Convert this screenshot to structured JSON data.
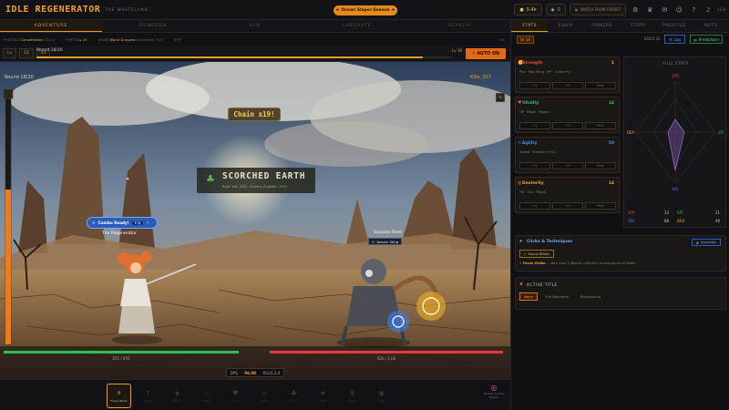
{
  "header": {
    "logo": "IDLE REGENERATOR",
    "sublogo": "THE WASTELAND",
    "season": "Ocean Slayer Season",
    "gold": "5.4k",
    "gems": "0",
    "action_link": "WATCH FROM FOREST",
    "icons": [
      "settings-icon",
      "trophy-icon",
      "mail-icon",
      "profile-icon",
      "help-icon",
      "music-icon"
    ],
    "right_label": "v1.9"
  },
  "left_tabs": [
    "ADVENTURE",
    "DUNGEON",
    "GYM",
    "LABORATE",
    "SEARCH"
  ],
  "status": {
    "feature_label": "FEATURE",
    "feature_value": "Constellation",
    "feature_extra": "CA1.0",
    "forte_label": "FORTE",
    "forte_value": "Lv 15",
    "mode_label": "MODE",
    "mode_value": "World Dungeon",
    "mode_extra": "Complete 23/3",
    "xp_label": "XP/T",
    "percent": "0%"
  },
  "round": {
    "lv_label": "Lv",
    "lv_value": "12",
    "spd": "x3",
    "label": "Round 18/20",
    "right_level": "Lv 18",
    "auto_label": "AUTO ON",
    "progress_fraction": 0.93
  },
  "scene": {
    "round_text": "Round 18/20",
    "kills_text": "Kills: 257",
    "chain_text": "Chain x19!",
    "zone_title": "SCORCHED EARTH",
    "zone_sub": "Rule: Hit -15% · Enemy Evasion -15%",
    "combo_text": "Combo Ready!",
    "combo_key": "F/Q",
    "player_name": "The Regenerator",
    "enemy_name": "Scorpion Fiend",
    "enemy_tag": "Venom Sting",
    "player_hp": "855 / 855",
    "enemy_hp": "62k / 1.0k",
    "dps_label": "DPS",
    "dps_value": "96.0K",
    "kills_label": "KILLS 3.4",
    "player_hp_fraction": 1.0,
    "enemy_hp_fraction": 1.0
  },
  "abilities": [
    {
      "icon": "lightning-icon",
      "label": "Focus Strike",
      "active": true
    },
    {
      "icon": "sword-icon",
      "label": "Slash",
      "active": false
    },
    {
      "icon": "shield-icon",
      "label": "Guard",
      "active": false
    },
    {
      "icon": "fire-icon",
      "label": "Blaze",
      "active": false
    },
    {
      "icon": "heart-icon",
      "label": "Mend",
      "active": false
    },
    {
      "icon": "skull-icon",
      "label": "Curse",
      "active": false
    },
    {
      "icon": "leaf-icon",
      "label": "Thorn",
      "active": false
    },
    {
      "icon": "star-icon",
      "label": "Nova",
      "active": false
    },
    {
      "icon": "crown-icon",
      "label": "Royal",
      "active": false
    },
    {
      "icon": "eye-icon",
      "label": "Gaze",
      "active": false
    }
  ],
  "ability_right": "Disable Combo Targets",
  "right_tabs": [
    "STATS",
    "EQUIP",
    "POWERS",
    "STORY",
    "PRESTIGE",
    "AUTO"
  ],
  "right_header": {
    "level": "LV 18",
    "xp": "854/2.2k",
    "log": "Log",
    "breakdown": "Breakdown"
  },
  "stats": [
    {
      "name": "Strength",
      "value": "1",
      "desc": "Phs · Max Dmg · HP · Crush Fly",
      "color": "#e8483c",
      "buttons": [
        "+1",
        "+5",
        "MAX"
      ]
    },
    {
      "name": "Vitality",
      "value": "14",
      "desc": "HP · Block · Regen",
      "color": "#3cc058",
      "buttons": [
        "+1",
        "+5",
        "MAX"
      ]
    },
    {
      "name": "Agility",
      "value": "50",
      "desc": "Speed · Evasion (+%)",
      "color": "#4a8ae8",
      "buttons": [
        "+1",
        "+5",
        "MAX"
      ]
    },
    {
      "name": "Dexterity",
      "value": "14",
      "desc": "Hit · Crit · Pierce",
      "color": "#f0a020",
      "buttons": [
        "+1",
        "+5",
        "MAX"
      ]
    }
  ],
  "full_stats": {
    "title": "FULL STATS",
    "axes": [
      "STR",
      "VIT",
      "AGI",
      "DEX"
    ],
    "rows": [
      {
        "label": "STR",
        "value": "33",
        "color": "#e8483c"
      },
      {
        "label": "VIT",
        "value": "21",
        "color": "#3cc058"
      },
      {
        "label": "AGI",
        "value": "88",
        "color": "#4a8ae8"
      },
      {
        "label": "DEX",
        "value": "49",
        "color": "#f0a020"
      }
    ]
  },
  "clicks": {
    "title": "Clicks & Techniques",
    "upgrade": "Upgrades",
    "chip": "Focus Strike",
    "desc_name": "Focus Strike",
    "desc": " — Your next 3 attacks critically hit and pierce all block."
  },
  "active_title": {
    "heading": "ACTIVE TITLE",
    "options": [
      "None",
      "The Wanderer",
      "Bloodbound"
    ],
    "selected": "None"
  }
}
